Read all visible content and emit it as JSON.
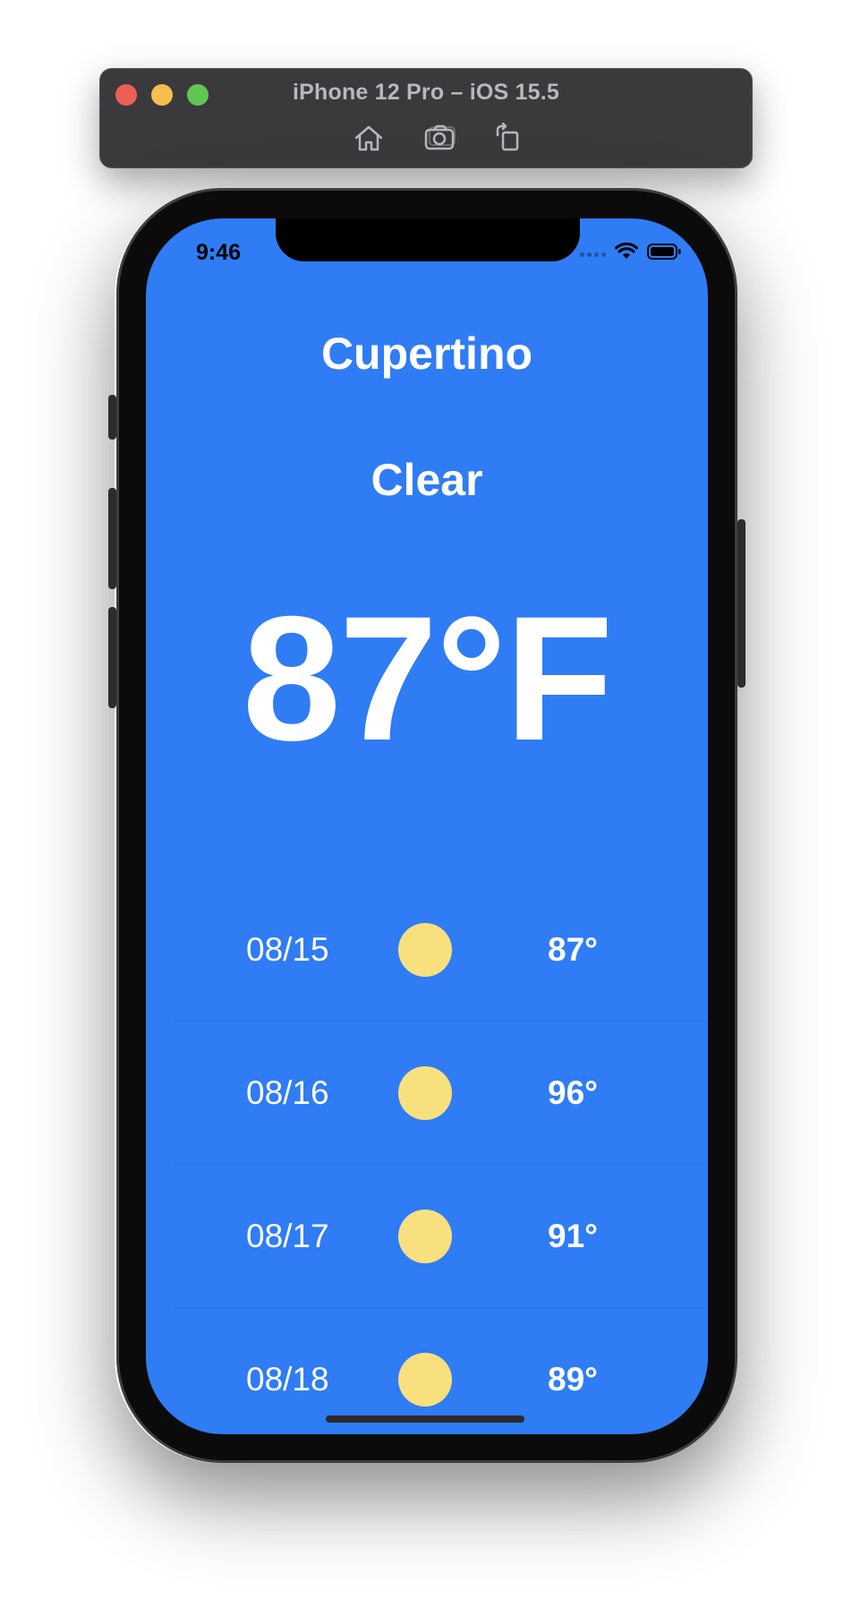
{
  "window": {
    "title": "iPhone 12 Pro – iOS 15.5",
    "tools": [
      {
        "icon": "home-icon"
      },
      {
        "icon": "screenshot-icon"
      },
      {
        "icon": "rotate-icon"
      }
    ]
  },
  "status_bar": {
    "time": "9:46",
    "icons": [
      "signal-icon",
      "wifi-icon",
      "battery-icon"
    ]
  },
  "weather": {
    "city": "Cupertino",
    "condition": "Clear",
    "temperature": "87°F",
    "forecast": [
      {
        "date": "08/15",
        "icon": "sun-icon",
        "temp": "87°"
      },
      {
        "date": "08/16",
        "icon": "sun-icon",
        "temp": "96°"
      },
      {
        "date": "08/17",
        "icon": "sun-icon",
        "temp": "91°"
      },
      {
        "date": "08/18",
        "icon": "sun-icon",
        "temp": "89°"
      }
    ]
  },
  "colors": {
    "background": "#2f7cf5",
    "sun": "#f9e07e",
    "text": "#ffffff"
  }
}
